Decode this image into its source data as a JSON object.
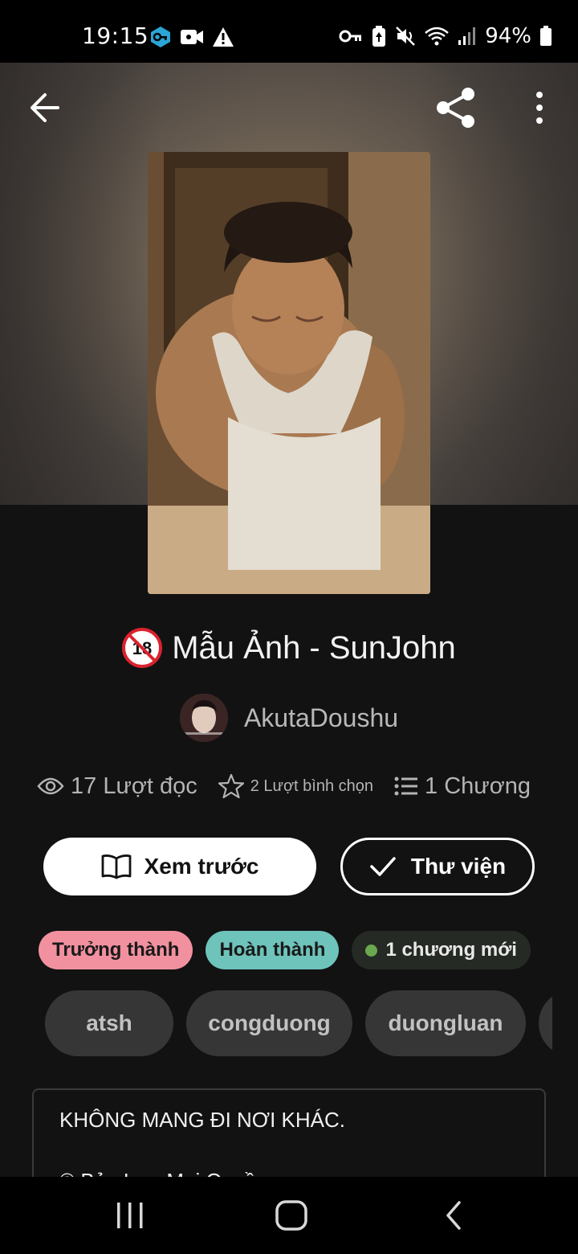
{
  "status_bar": {
    "time": "19:15",
    "left_icons": [
      "vpn-key-icon",
      "video-record-icon",
      "warning-icon"
    ],
    "right_icons": [
      "key-icon",
      "battery-saver-icon",
      "mute-icon",
      "wifi-icon",
      "signal-icon"
    ],
    "battery_percent": "94%"
  },
  "header": {
    "icons": [
      "back-arrow-icon",
      "share-icon",
      "more-vertical-icon"
    ]
  },
  "story": {
    "age_badge_icon": "18-plus-icon",
    "title": "Mẫu Ảnh - SunJohn",
    "author": "AkutaDoushu"
  },
  "stats": {
    "reads": "17 Lượt đọc",
    "votes": "2 Lượt bình chọn",
    "chapters": "1 Chương"
  },
  "actions": {
    "preview_label": "Xem trước",
    "library_label": "Thư viện"
  },
  "badges": {
    "mature": "Trưởng thành",
    "complete": "Hoàn thành",
    "new_chapter": "1 chương mới"
  },
  "tags": [
    "atsh",
    "congduong",
    "duongluan"
  ],
  "description": {
    "line1": "KHÔNG MANG ĐI NƠI KHÁC.",
    "line2": "© Bản Lưu Mai Quyền"
  },
  "nav_bar": {
    "icons": [
      "recents-icon",
      "home-icon",
      "back-icon"
    ]
  },
  "colors": {
    "background": "#121212",
    "mature_badge": "#f1919f",
    "complete_badge": "#6ec3bb",
    "new_dot": "#6aa84f",
    "tag_background": "#363636"
  }
}
